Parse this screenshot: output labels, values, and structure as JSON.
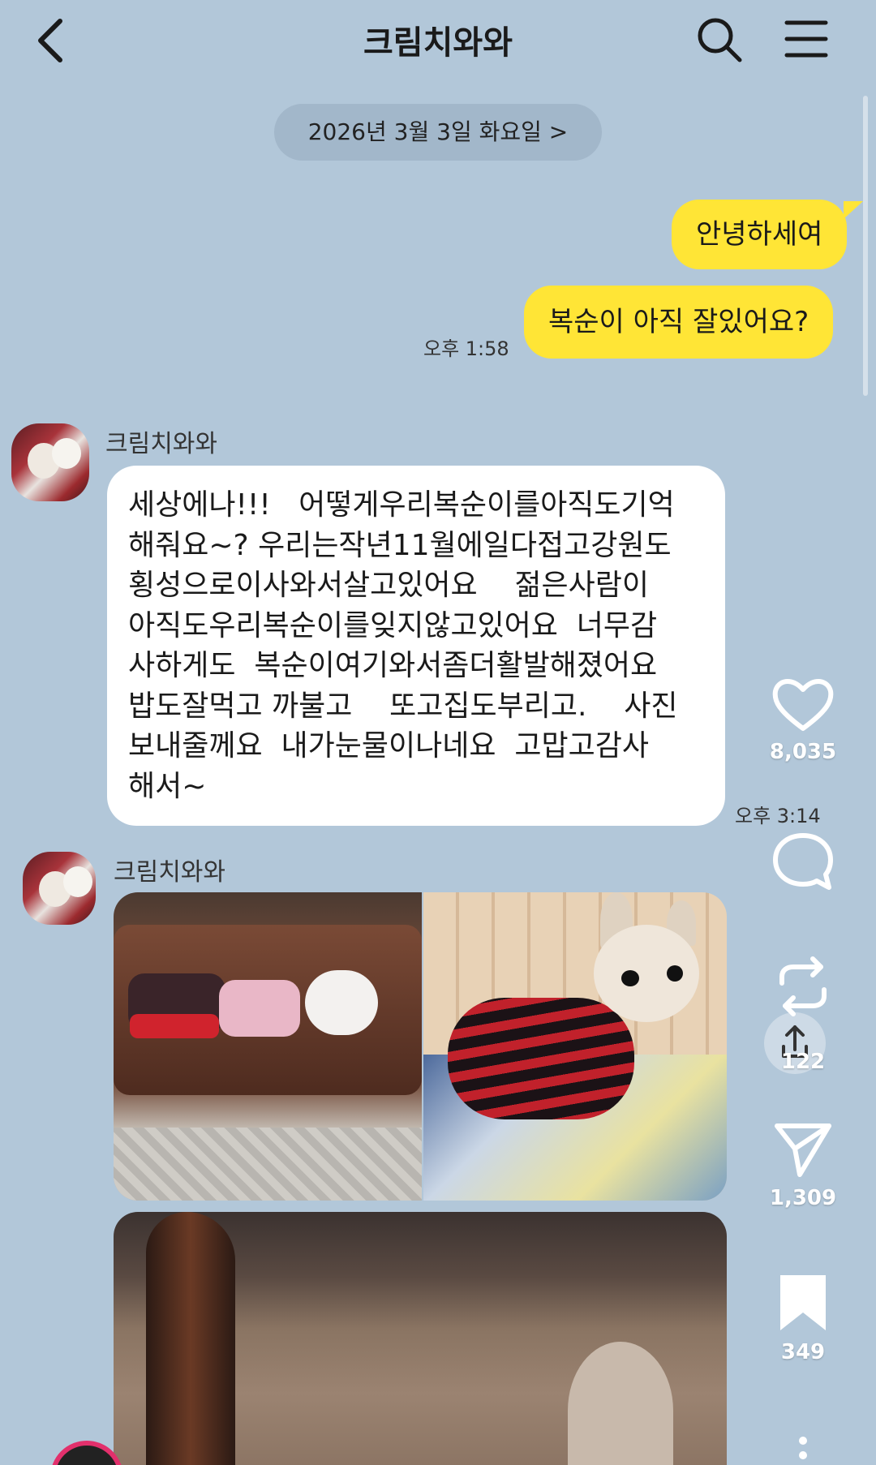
{
  "header": {
    "title": "크림치와와",
    "back_icon": "chevron-left-icon",
    "search_icon": "search-icon",
    "menu_icon": "hamburger-menu-icon"
  },
  "date_divider": {
    "label": "2026년 3월 3일 화요일 >"
  },
  "messages_me": [
    {
      "text": "안녕하세여"
    },
    {
      "text": "복순이 아직 잘있어요?"
    }
  ],
  "time_me": "오후 1:58",
  "message_them": {
    "sender": "크림치와와",
    "lines": [
      "세상에나!!!   어떻게우리복순이를아직도기억",
      "해줘요~? 우리는작년11월에일다접고강원도",
      "횡성으로이사와서살고있어요    젊은사람이",
      "아직도우리복순이를잊지않고있어요  너무감",
      "사하게도  복순이여기와서좀더활발해졌어요",
      "밥도잘먹고 까불고    또고집도부리고.    사진",
      "보내줄께요  내가눈물이나네요  고맙고감사",
      "해서~"
    ],
    "time": "오후 3:14"
  },
  "photo_message": {
    "sender": "크림치와와"
  },
  "sidebar": {
    "like_count": "8,035",
    "repost_count": "122",
    "send_count": "1,309",
    "save_count": "349"
  },
  "colors": {
    "background": "#b2c7d9",
    "my_bubble": "#ffe536",
    "their_bubble": "#ffffff"
  }
}
